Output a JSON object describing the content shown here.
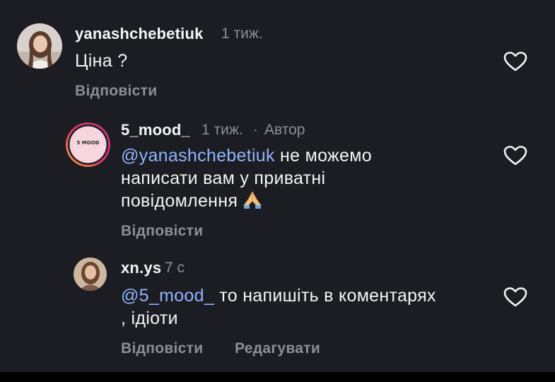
{
  "comments": [
    {
      "username": "yanashchebetiuk",
      "time": "1 тиж.",
      "author_badge": "",
      "text": "Ціна ?",
      "actions": {
        "reply": "Відповісти"
      }
    },
    {
      "username": "5_mood_",
      "time": "1 тиж.",
      "separator": "·",
      "author_badge": "Автор",
      "avatar_logo_text": "5 MOOD",
      "mention": "@yanashchebetiuk",
      "text_line1": " не можемо",
      "text_line2": "написати вам у приватні",
      "text_line3": "повідомлення",
      "emoji": "folded-hands",
      "actions": {
        "reply": "Відповісти"
      }
    },
    {
      "username": "xn.ys",
      "time": "7 с",
      "mention": "@5_mood_",
      "text_line1": " то напишіть в коментарях",
      "text_line2": ", ідіоти",
      "actions": {
        "reply": "Відповісти",
        "edit": "Редагувати"
      }
    }
  ],
  "colors": {
    "background": "#1c1d22",
    "text": "#f5f5f5",
    "secondary": "#8e8e93",
    "mention": "#8fb4ff",
    "story_ring": "#c13584"
  }
}
